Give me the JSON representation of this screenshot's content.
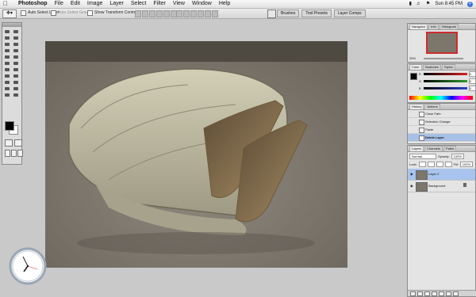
{
  "menubar": {
    "items": [
      "Photoshop",
      "File",
      "Edit",
      "Image",
      "Layer",
      "Select",
      "Filter",
      "View",
      "Window",
      "Help"
    ],
    "clock": "Sun 8:45 PM"
  },
  "options": {
    "auto_select_layer": "Auto Select Layer",
    "auto_select_groups": "Auto Select Groups",
    "show_transform_controls": "Show Transform Controls"
  },
  "palette_well": {
    "tabs": [
      "Brushes",
      "Tool Presets",
      "Layer Comps"
    ]
  },
  "navigator": {
    "tabs": [
      "Navigator",
      "Info",
      "Histogram"
    ],
    "zoom": "25%"
  },
  "color_panel": {
    "tabs": [
      "Color",
      "Swatches",
      "Styles"
    ],
    "channels": [
      {
        "label": "R",
        "value": "0"
      },
      {
        "label": "G",
        "value": "0"
      },
      {
        "label": "B",
        "value": "0"
      }
    ],
    "colors": {
      "r": "#d62020",
      "g": "#2f9b2f",
      "b": "#2f3fd0"
    }
  },
  "history": {
    "tabs": [
      "History",
      "Actions"
    ],
    "items": [
      "Close Path",
      "Selection Change",
      "Paste",
      "Delete Layer"
    ],
    "selected_index": 3
  },
  "layers": {
    "tabs": [
      "Layers",
      "Channels",
      "Paths"
    ],
    "blend_mode": "Normal",
    "opacity_label": "Opacity:",
    "opacity_value": "100%",
    "lock_label": "Lock:",
    "fill_label": "Fill:",
    "fill_value": "100%",
    "items": [
      {
        "name": "Layer 2",
        "active": true
      },
      {
        "name": "Background",
        "active": false
      }
    ]
  }
}
